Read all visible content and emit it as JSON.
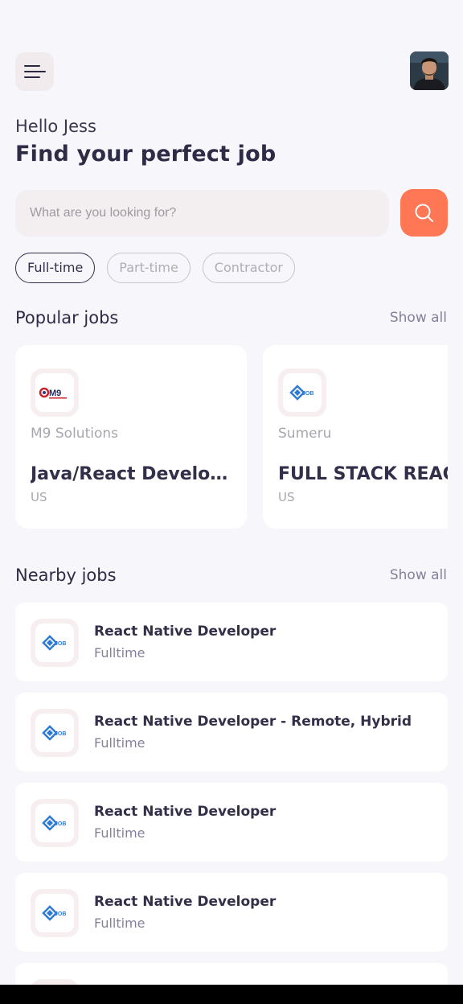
{
  "header": {
    "menu_icon": "menu-icon",
    "avatar_alt": "Profile photo"
  },
  "welcome": {
    "greeting": "Hello Jess",
    "headline": "Find your perfect job"
  },
  "search": {
    "placeholder": "What are you looking for?",
    "button_icon": "search-icon",
    "accent_color": "#ff7754"
  },
  "job_types": [
    {
      "label": "Full-time",
      "active": true
    },
    {
      "label": "Part-time",
      "active": false
    },
    {
      "label": "Contractor",
      "active": false
    }
  ],
  "popular": {
    "title": "Popular jobs",
    "show_all": "Show all",
    "cards": [
      {
        "company": "M9 Solutions",
        "title": "Java/React Develop...",
        "country": "US",
        "logo": "m9-logo"
      },
      {
        "company": "Sumeru",
        "title": "FULL STACK REACT",
        "country": "US",
        "logo": "job-logo"
      }
    ]
  },
  "nearby": {
    "title": "Nearby jobs",
    "show_all": "Show all",
    "jobs": [
      {
        "title": "React Native Developer",
        "type": "Fulltime",
        "logo": "job-logo"
      },
      {
        "title": "React Native Developer - Remote, Hybrid",
        "type": "Fulltime",
        "logo": "job-logo"
      },
      {
        "title": "React Native Developer",
        "type": "Fulltime",
        "logo": "job-logo"
      },
      {
        "title": "React Native Developer",
        "type": "Fulltime",
        "logo": "job-logo"
      }
    ]
  }
}
